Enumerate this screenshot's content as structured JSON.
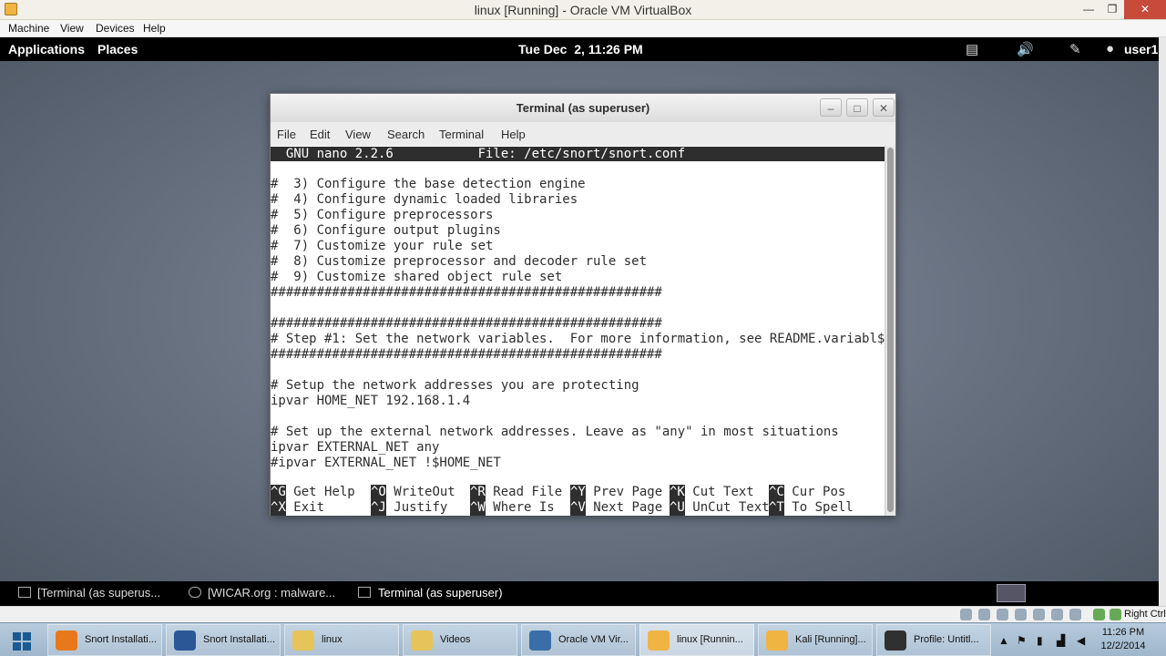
{
  "vbox": {
    "title": "linux [Running] - Oracle VM VirtualBox",
    "controls": {
      "minimize": "—",
      "restore": "❐",
      "close": "✕"
    },
    "menu": [
      "Machine",
      "View",
      "Devices",
      "Help"
    ]
  },
  "gnome_top": {
    "applications": "Applications",
    "places": "Places",
    "clock": "Tue Dec  2, 11:26 PM",
    "user": "user1"
  },
  "terminal": {
    "title": "Terminal (as superuser)",
    "controls": {
      "minimize": "–",
      "maximize": "□",
      "close": "✕"
    },
    "menu": [
      "File",
      "Edit",
      "View",
      "Search",
      "Terminal",
      "Help"
    ],
    "nano_header": "  GNU nano 2.2.6           File: /etc/snort/snort.conf",
    "lines": [
      "",
      "#  3) Configure the base detection engine",
      "#  4) Configure dynamic loaded libraries",
      "#  5) Configure preprocessors",
      "#  6) Configure output plugins",
      "#  7) Customize your rule set",
      "#  8) Customize preprocessor and decoder rule set",
      "#  9) Customize shared object rule set",
      "###################################################",
      "",
      "###################################################",
      "# Step #1: Set the network variables.  For more information, see README.variabl$",
      "###################################################",
      "",
      "# Setup the network addresses you are protecting",
      "ipvar HOME_NET 192.168.1.4",
      "",
      "# Set up the external network addresses. Leave as \"any\" in most situations",
      "ipvar EXTERNAL_NET any",
      "#ipvar EXTERNAL_NET !$HOME_NET",
      ""
    ],
    "shortcuts_row1": [
      {
        "key": "^G",
        "label": "Get Help"
      },
      {
        "key": "^O",
        "label": "WriteOut"
      },
      {
        "key": "^R",
        "label": "Read File"
      },
      {
        "key": "^Y",
        "label": "Prev Page"
      },
      {
        "key": "^K",
        "label": "Cut Text"
      },
      {
        "key": "^C",
        "label": "Cur Pos"
      }
    ],
    "shortcuts_row2": [
      {
        "key": "^X",
        "label": "Exit"
      },
      {
        "key": "^J",
        "label": "Justify"
      },
      {
        "key": "^W",
        "label": "Where Is"
      },
      {
        "key": "^V",
        "label": "Next Page"
      },
      {
        "key": "^U",
        "label": "UnCut Text"
      },
      {
        "key": "^T",
        "label": "To Spell"
      }
    ]
  },
  "gnome_bottom": {
    "tasks": [
      "[Terminal (as superus...",
      "[WICAR.org : malware...",
      "Terminal (as superuser)"
    ]
  },
  "vbox_status": {
    "host_key": "Right Ctrl"
  },
  "taskbar": {
    "items": [
      {
        "label": "Snort Installati...",
        "color": "#e8781a"
      },
      {
        "label": "Snort Installati...",
        "color": "#2b5797"
      },
      {
        "label": "linux",
        "color": "#e6c45a"
      },
      {
        "label": "Videos",
        "color": "#e6c45a"
      },
      {
        "label": "Oracle VM Vir...",
        "color": "#3a6ea8"
      },
      {
        "label": "linux [Runnin...",
        "color": "#f0b442"
      },
      {
        "label": "Kali [Running]...",
        "color": "#f0b442"
      },
      {
        "label": "Profile: Untitl...",
        "color": "#303030"
      }
    ],
    "time": "11:26 PM",
    "date": "12/2/2014"
  }
}
